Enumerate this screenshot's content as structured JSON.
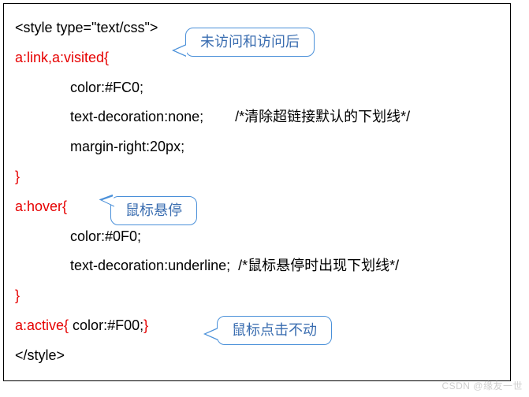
{
  "code": {
    "l1": "<style type=\"text/css\">",
    "l2": "a:link,a:visited{",
    "l3": "color:#FC0;",
    "l4a": "text-decoration:none;",
    "l4b": "/*清除超链接默认的下划线*/",
    "l5": "margin-right:20px;",
    "l6": "}",
    "l7": "a:hover{",
    "l8": "color:#0F0;",
    "l9a": "text-decoration:underline;",
    "l9b": "/*鼠标悬停时出现下划线*/",
    "l10": "}",
    "l11a": "a:active{",
    "l11b": " color:#F00;",
    "l11c": "}",
    "l12": "</style>"
  },
  "callouts": {
    "c1": "未访问和访问后",
    "c2": "鼠标悬停",
    "c3": "鼠标点击不动"
  },
  "watermark": "CSDN @缘友一世"
}
